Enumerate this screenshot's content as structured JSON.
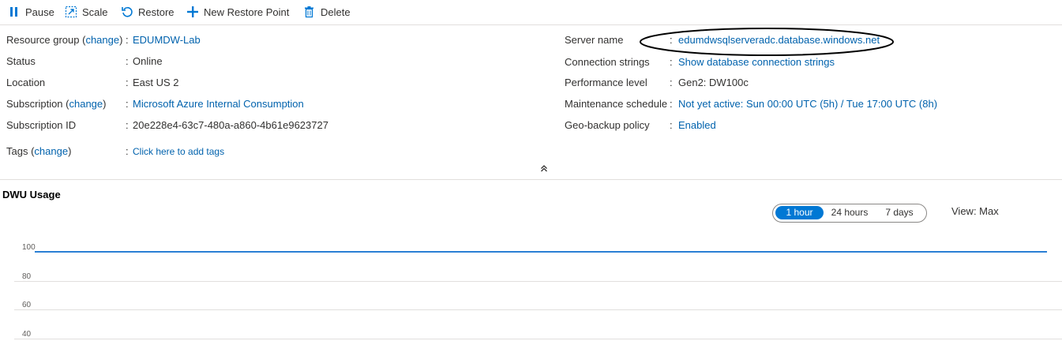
{
  "toolbar": {
    "pause": "Pause",
    "scale": "Scale",
    "restore": "Restore",
    "new_restore_point": "New Restore Point",
    "delete": "Delete"
  },
  "essentials": {
    "left": [
      {
        "label": "Resource group (",
        "change": "change",
        "label_after": ")",
        "value": "EDUMDW-Lab",
        "is_link": true
      },
      {
        "label": "Status",
        "value": "Online",
        "is_link": false
      },
      {
        "label": "Location",
        "value": "East US 2",
        "is_link": false
      },
      {
        "label": "Subscription (",
        "change": "change",
        "label_after": ")",
        "value": "Microsoft Azure Internal Consumption",
        "is_link": true
      },
      {
        "label": "Subscription ID",
        "value": "20e228e4-63c7-480a-a860-4b61e9623727",
        "is_link": false
      },
      {
        "label": "Tags (",
        "change": "change",
        "label_after": ")",
        "value": "Click here to add tags",
        "is_link": true
      }
    ],
    "right": [
      {
        "label": "Server name",
        "value": "edumdwsqlserveradc.database.windows.net",
        "is_link": true
      },
      {
        "label": "Connection strings",
        "value": "Show database connection strings",
        "is_link": true
      },
      {
        "label": "Performance level",
        "value": "Gen2: DW100c",
        "is_link": false
      },
      {
        "label": "Maintenance schedule",
        "value": "Not yet active: Sun 00:00 UTC (5h) / Tue 17:00 UTC (8h)",
        "is_link": true
      },
      {
        "label": "Geo-backup policy",
        "value": "Enabled",
        "is_link": true
      }
    ],
    "colon": ":"
  },
  "chart": {
    "title": "DWU Usage",
    "time_ranges": [
      "1 hour",
      "24 hours",
      "7 days"
    ],
    "selected_range": "1 hour",
    "view": "View: Max"
  },
  "chart_data": {
    "type": "line",
    "title": "DWU Usage",
    "yticks": [
      "100",
      "80",
      "60",
      "40"
    ],
    "series": [
      {
        "values": [
          100,
          100
        ]
      }
    ],
    "accent_color": "#0078d4",
    "line_color": "#2a7fd4"
  }
}
